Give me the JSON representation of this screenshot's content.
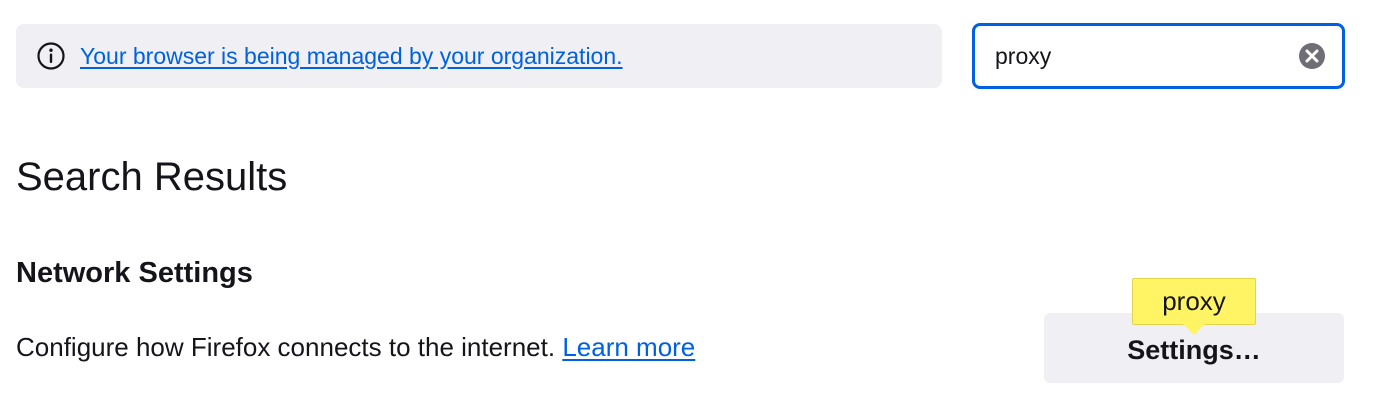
{
  "notice": {
    "icon": "info-icon",
    "link_text": "Your browser is being managed by your organization."
  },
  "search": {
    "value": "proxy",
    "clear_icon": "clear-icon"
  },
  "results": {
    "title": "Search Results"
  },
  "network_section": {
    "title": "Network Settings",
    "description": "Configure how Firefox connects to the internet.",
    "learn_more_label": "Learn more",
    "settings_button_label": "Settings…",
    "highlight_tooltip": "proxy"
  },
  "colors": {
    "accent": "#0061e0",
    "notice_bg": "#f0f0f4",
    "tooltip_bg": "#fff464",
    "text": "#15141a"
  }
}
